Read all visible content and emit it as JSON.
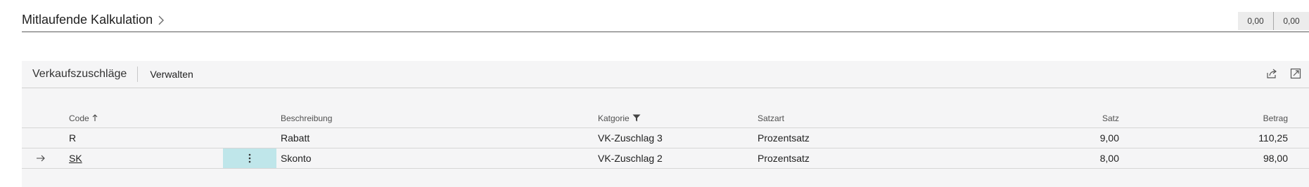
{
  "header": {
    "title": "Mitlaufende Kalkulation",
    "values": [
      "0,00",
      "0,00"
    ]
  },
  "panel": {
    "title": "Verkaufszuschläge",
    "action_label": "Verwalten",
    "icons": [
      "share-icon",
      "expand-icon"
    ]
  },
  "table": {
    "columns": {
      "code": "Code",
      "beschreibung": "Beschreibung",
      "kategorie": "Katgorie",
      "satzart": "Satzart",
      "satz": "Satz",
      "betrag": "Betrag"
    },
    "rows": [
      {
        "code": "R",
        "beschreibung": "Rabatt",
        "kategorie": "VK-Zuschlag 3",
        "satzart": "Prozentsatz",
        "satz": "9,00",
        "betrag": "110,25",
        "selected": false
      },
      {
        "code": "SK",
        "beschreibung": "Skonto",
        "kategorie": "VK-Zuschlag 2",
        "satzart": "Prozentsatz",
        "satz": "8,00",
        "betrag": "98,00",
        "selected": true
      }
    ]
  },
  "colors": {
    "accent_selection": "#bfe6ea",
    "panel_background": "#f5f5f6",
    "header_value_background": "#ececec"
  }
}
